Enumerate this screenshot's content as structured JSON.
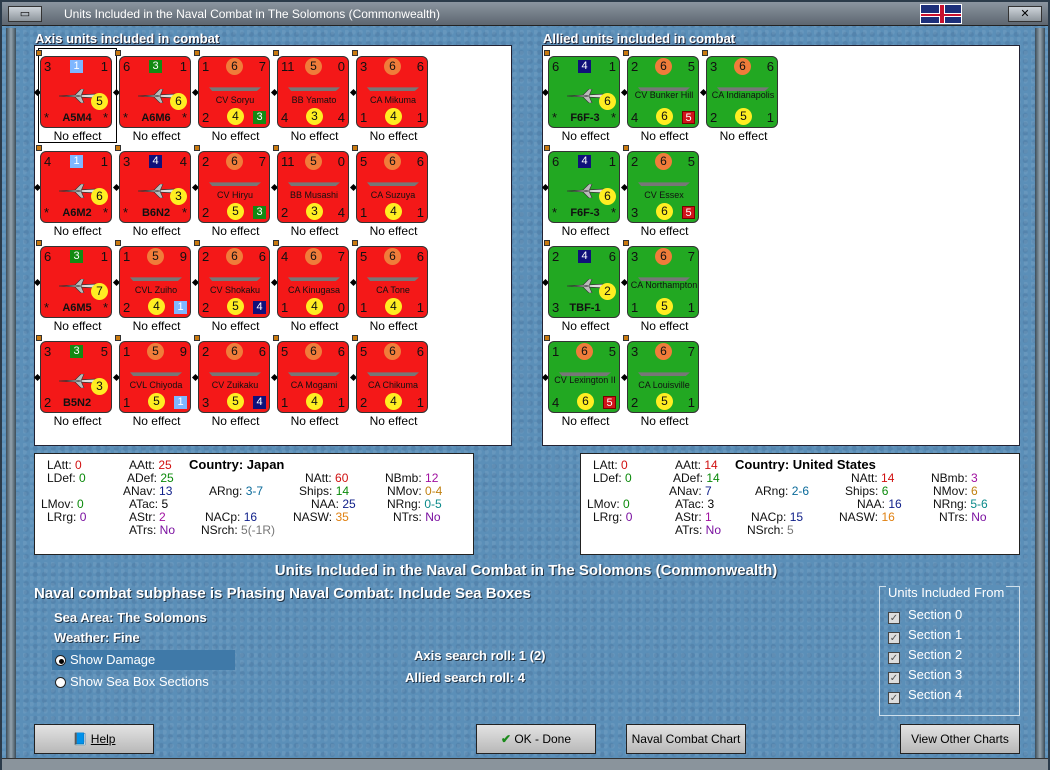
{
  "window": {
    "title": "Units Included in the Naval Combat in The Solomons (Commonwealth)"
  },
  "axis": {
    "header": "Axis units included in combat",
    "units": [
      {
        "kind": "air",
        "name": "A5M4",
        "tl": "3",
        "tr": "1",
        "sq": "1",
        "sqc": "blue",
        "yc": "5",
        "bl": "*",
        "br": "*",
        "effect": "No effect",
        "selected": true
      },
      {
        "kind": "air",
        "name": "A6M6",
        "tl": "6",
        "tr": "1",
        "sq": "3",
        "sqc": "dg",
        "yc": "6",
        "bl": "*",
        "br": "*",
        "effect": "No effect"
      },
      {
        "kind": "ship",
        "name": "CV Soryu",
        "tl": "1",
        "mid": "6",
        "tr": "7",
        "bl": "2",
        "yc": "4",
        "sq": "3",
        "sqc": "dg",
        "effect": "No effect"
      },
      {
        "kind": "ship",
        "name": "BB Yamato",
        "tl": "11",
        "mid": "5",
        "tr": "0",
        "bl": "4",
        "yc": "3",
        "br": "4",
        "effect": "No effect"
      },
      {
        "kind": "ship",
        "name": "CA Mikuma",
        "tl": "3",
        "mid": "6",
        "tr": "6",
        "bl": "1",
        "yc": "4",
        "br": "1",
        "effect": "No effect"
      },
      {
        "kind": "air",
        "name": "A6M2",
        "tl": "4",
        "tr": "1",
        "sq": "1",
        "sqc": "blue",
        "yc": "6",
        "bl": "*",
        "br": "*",
        "effect": "No effect"
      },
      {
        "kind": "air",
        "name": "B6N2",
        "tl": "3",
        "tr": "4",
        "sq": "4",
        "sqc": "navy",
        "yc": "3",
        "bl": "*",
        "br": "*",
        "effect": "No effect"
      },
      {
        "kind": "ship",
        "name": "CV Hiryu",
        "tl": "2",
        "mid": "6",
        "tr": "7",
        "bl": "2",
        "yc": "5",
        "sq": "3",
        "sqc": "dg",
        "effect": "No effect"
      },
      {
        "kind": "ship",
        "name": "BB Musashi",
        "tl": "11",
        "mid": "5",
        "tr": "0",
        "bl": "2",
        "yc": "3",
        "br": "4",
        "effect": "No effect"
      },
      {
        "kind": "ship",
        "name": "CA Suzuya",
        "tl": "5",
        "mid": "6",
        "tr": "6",
        "bl": "1",
        "yc": "4",
        "br": "1",
        "effect": "No effect"
      },
      {
        "kind": "air",
        "name": "A6M5",
        "tl": "6",
        "tr": "1",
        "sq": "3",
        "sqc": "dg",
        "yc": "7",
        "bl": "*",
        "br": "*",
        "effect": "No effect"
      },
      {
        "kind": "ship",
        "name": "CVL Zuiho",
        "tl": "1",
        "mid": "5",
        "tr": "9",
        "bl": "2",
        "yc": "4",
        "sq": "1",
        "sqc": "blue",
        "effect": "No effect"
      },
      {
        "kind": "ship",
        "name": "CV Shokaku",
        "tl": "2",
        "mid": "6",
        "tr": "6",
        "bl": "2",
        "yc": "5",
        "sq": "4",
        "sqc": "navy",
        "effect": "No effect"
      },
      {
        "kind": "ship",
        "name": "CA Kinugasa",
        "tl": "4",
        "mid": "6",
        "tr": "7",
        "bl": "1",
        "yc": "4",
        "br": "0",
        "effect": "No effect"
      },
      {
        "kind": "ship",
        "name": "CA Tone",
        "tl": "5",
        "mid": "6",
        "tr": "6",
        "bl": "1",
        "yc": "4",
        "br": "1",
        "effect": "No effect"
      },
      {
        "kind": "air",
        "name": "B5N2",
        "tl": "3",
        "tr": "5",
        "sq": "3",
        "sqc": "dg",
        "yc": "3",
        "bl": "2",
        "br": "",
        "effect": "No effect"
      },
      {
        "kind": "ship",
        "name": "CVL Chiyoda",
        "tl": "1",
        "mid": "5",
        "tr": "9",
        "bl": "1",
        "yc": "5",
        "sq": "1",
        "sqc": "blue",
        "effect": "No effect"
      },
      {
        "kind": "ship",
        "name": "CV Zuikaku",
        "tl": "2",
        "mid": "6",
        "tr": "6",
        "bl": "3",
        "yc": "5",
        "sq": "4",
        "sqc": "navy",
        "effect": "No effect"
      },
      {
        "kind": "ship",
        "name": "CA Mogami",
        "tl": "5",
        "mid": "6",
        "tr": "6",
        "bl": "1",
        "yc": "4",
        "br": "1",
        "effect": "No effect"
      },
      {
        "kind": "ship",
        "name": "CA Chikuma",
        "tl": "5",
        "mid": "6",
        "tr": "6",
        "bl": "2",
        "yc": "4",
        "br": "1",
        "effect": "No effect"
      }
    ],
    "stats": {
      "LAtt": "0",
      "LDef": "0",
      "LMov": "0",
      "LRrg": "0",
      "AAtt": "25",
      "ADef": "25",
      "ANav": "13",
      "ATac": "5",
      "AStr": "2",
      "ATrs": "No",
      "country_label": "Country:",
      "country": "Japan",
      "ARng": "3-7",
      "NACp": "16",
      "NSrch": "5(-1R)",
      "NAtt": "60",
      "Ships": "14",
      "NAA": "25",
      "NASW": "35",
      "NBmb": "12",
      "NMov": "0-4",
      "NRng": "0-5",
      "NTrs": "No"
    }
  },
  "allied": {
    "header": "Allied units included in combat",
    "cols": [
      [
        {
          "kind": "air",
          "name": "F6F-3",
          "tl": "6",
          "tr": "1",
          "sq": "4",
          "sqc": "navy",
          "yc": "6",
          "bl": "*",
          "br": "*",
          "effect": "No effect"
        },
        {
          "kind": "air",
          "name": "F6F-3",
          "tl": "6",
          "tr": "1",
          "sq": "4",
          "sqc": "navy",
          "yc": "6",
          "bl": "*",
          "br": "*",
          "effect": "No effect"
        },
        {
          "kind": "air",
          "name": "TBF-1",
          "tl": "2",
          "tr": "6",
          "sq": "4",
          "sqc": "navy",
          "yc": "2",
          "bl": "3",
          "br": "",
          "effect": "No effect"
        },
        {
          "kind": "ship",
          "name": "CV Lexington II",
          "tl": "1",
          "mid": "6",
          "tr": "5",
          "bl": "4",
          "yc": "6",
          "sq": "5",
          "sqc": "red",
          "effect": "No effect"
        }
      ],
      [
        {
          "kind": "ship",
          "name": "CV Bunker Hill",
          "tl": "2",
          "mid": "6",
          "tr": "5",
          "bl": "4",
          "yc": "6",
          "sq": "5",
          "sqc": "red",
          "effect": "No effect"
        },
        {
          "kind": "ship",
          "name": "CV Essex",
          "tl": "2",
          "mid": "6",
          "tr": "5",
          "bl": "3",
          "yc": "6",
          "sq": "5",
          "sqc": "red",
          "effect": "No effect"
        },
        {
          "kind": "ship",
          "name": "CA Northampton",
          "tl": "3",
          "mid": "6",
          "tr": "7",
          "bl": "1",
          "yc": "5",
          "br": "1",
          "effect": "No effect"
        },
        {
          "kind": "ship",
          "name": "CA Louisville",
          "tl": "3",
          "mid": "6",
          "tr": "7",
          "bl": "2",
          "yc": "5",
          "br": "1",
          "effect": "No effect"
        }
      ],
      [
        {
          "kind": "ship",
          "name": "CA Indianapolis",
          "tl": "3",
          "mid": "6",
          "tr": "6",
          "bl": "2",
          "yc": "5",
          "br": "1",
          "effect": "No effect"
        }
      ]
    ],
    "stats": {
      "LAtt": "0",
      "LDef": "0",
      "LMov": "0",
      "LRrg": "0",
      "AAtt": "14",
      "ADef": "14",
      "ANav": "7",
      "ATac": "3",
      "AStr": "1",
      "ATrs": "No",
      "country_label": "Country:",
      "country": "United States",
      "ARng": "2-6",
      "NACp": "15",
      "NSrch": "5",
      "NAtt": "14",
      "Ships": "6",
      "NAA": "16",
      "NASW": "16",
      "NBmb": "3",
      "NMov": "6",
      "NRng": "5-6",
      "NTrs": "No"
    }
  },
  "summary": {
    "title": "Units Included in the Naval Combat in The Solomons (Commonwealth)",
    "subphase": "Naval combat subphase is Phasing Naval Combat: Include Sea Boxes",
    "sea_area_label": "Sea Area:",
    "sea_area": "The Solomons",
    "weather_label": "Weather:",
    "weather": "Fine",
    "axis_roll": "Axis search roll: 1 (2)",
    "allied_roll": "Allied search roll: 4",
    "radio_damage": "Show Damage",
    "radio_sections": "Show Sea Box Sections"
  },
  "units_from": {
    "legend": "Units Included From",
    "sections": [
      "Section 0",
      "Section 1",
      "Section 2",
      "Section 3",
      "Section 4"
    ]
  },
  "buttons": {
    "help": "Help",
    "ok": "OK - Done",
    "chart": "Naval Combat Chart",
    "other": "View Other Charts"
  },
  "colors": {
    "axis_counter": "#f41818",
    "allied_counter": "#22a822",
    "dialog_bg": "#5b8fb8"
  }
}
